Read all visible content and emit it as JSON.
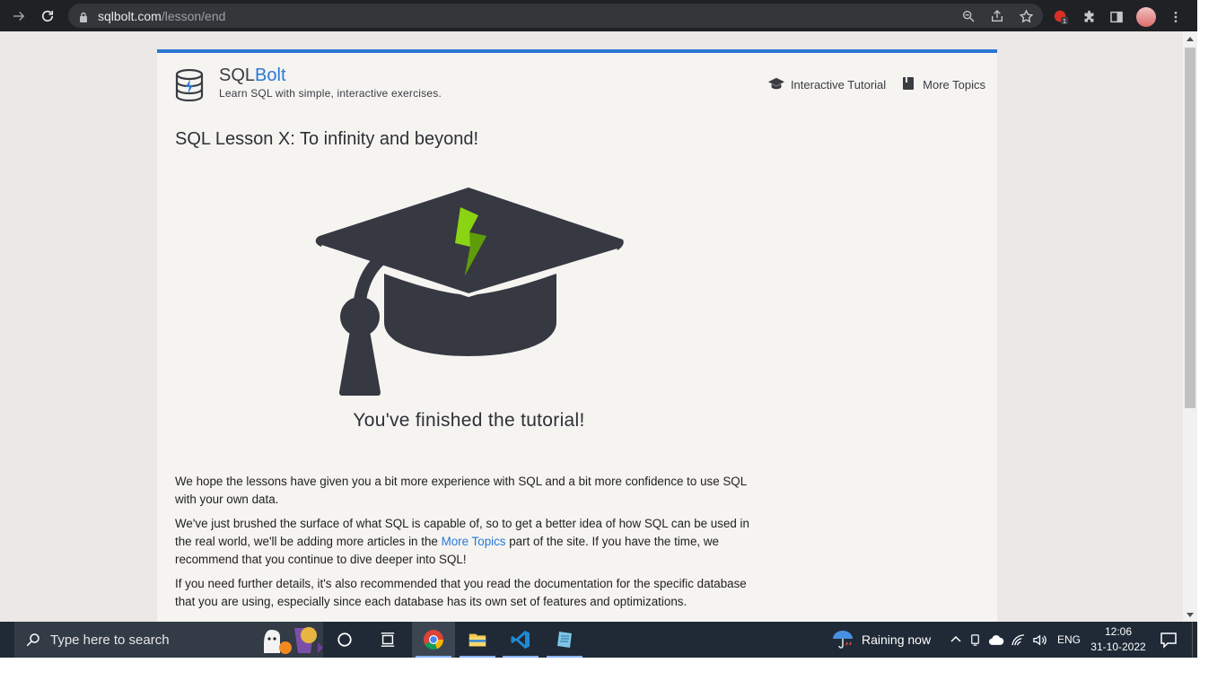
{
  "browser": {
    "url_domain": "sqlbolt.com",
    "url_path": "/lesson/end"
  },
  "site": {
    "brand_prefix": "SQL",
    "brand_suffix": "Bolt",
    "tagline": "Learn SQL with simple, interactive exercises.",
    "nav": [
      {
        "label": "Interactive Tutorial",
        "icon": "graduation-cap-icon"
      },
      {
        "label": "More Topics",
        "icon": "book-icon"
      }
    ]
  },
  "lesson": {
    "title": "SQL Lesson X: To infinity and beyond!",
    "finished": "You've finished the tutorial!",
    "p1": "We hope the lessons have given you a bit more experience with SQL and a bit more confidence to use SQL with your own data.",
    "p2_before": "We've just brushed the surface of what SQL is capable of, so to get a better idea of how SQL can be used in the real world, we'll be adding more articles in the ",
    "p2_link": "More Topics",
    "p2_after": " part of the site. If you have the time, we recommend that you continue to dive deeper into SQL!",
    "p3": "If you need further details, it's also recommended that you read the documentation for the specific database that you are using, especially since each database has its own set of features and optimizations."
  },
  "taskbar": {
    "search_placeholder": "Type here to search",
    "weather": "Raining now",
    "language": "ENG",
    "time": "12:06",
    "date": "31-10-2022"
  },
  "colors": {
    "accent": "#2a78d6",
    "page_bg": "#ebe8e5",
    "card_bg": "#f5f4f1",
    "bolt_green": "#8ad414"
  }
}
